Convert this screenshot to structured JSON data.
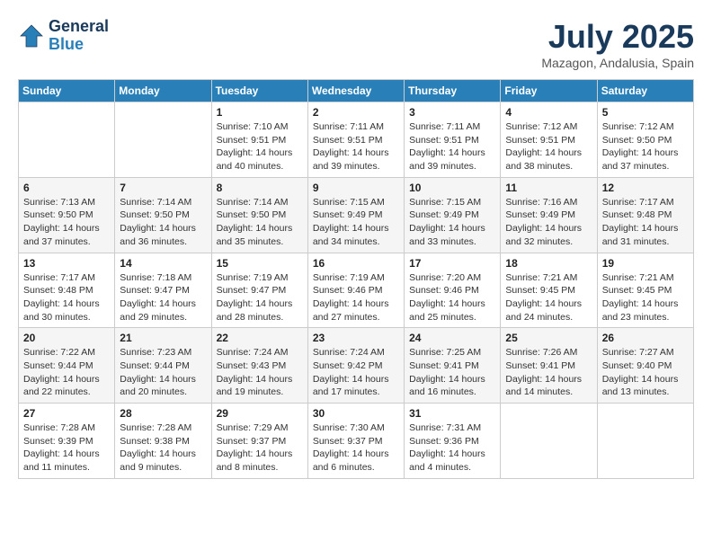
{
  "header": {
    "logo_line1": "General",
    "logo_line2": "Blue",
    "month_year": "July 2025",
    "location": "Mazagon, Andalusia, Spain"
  },
  "weekdays": [
    "Sunday",
    "Monday",
    "Tuesday",
    "Wednesday",
    "Thursday",
    "Friday",
    "Saturday"
  ],
  "weeks": [
    [
      {
        "day": "",
        "info": ""
      },
      {
        "day": "",
        "info": ""
      },
      {
        "day": "1",
        "info": "Sunrise: 7:10 AM\nSunset: 9:51 PM\nDaylight: 14 hours and 40 minutes."
      },
      {
        "day": "2",
        "info": "Sunrise: 7:11 AM\nSunset: 9:51 PM\nDaylight: 14 hours and 39 minutes."
      },
      {
        "day": "3",
        "info": "Sunrise: 7:11 AM\nSunset: 9:51 PM\nDaylight: 14 hours and 39 minutes."
      },
      {
        "day": "4",
        "info": "Sunrise: 7:12 AM\nSunset: 9:51 PM\nDaylight: 14 hours and 38 minutes."
      },
      {
        "day": "5",
        "info": "Sunrise: 7:12 AM\nSunset: 9:50 PM\nDaylight: 14 hours and 37 minutes."
      }
    ],
    [
      {
        "day": "6",
        "info": "Sunrise: 7:13 AM\nSunset: 9:50 PM\nDaylight: 14 hours and 37 minutes."
      },
      {
        "day": "7",
        "info": "Sunrise: 7:14 AM\nSunset: 9:50 PM\nDaylight: 14 hours and 36 minutes."
      },
      {
        "day": "8",
        "info": "Sunrise: 7:14 AM\nSunset: 9:50 PM\nDaylight: 14 hours and 35 minutes."
      },
      {
        "day": "9",
        "info": "Sunrise: 7:15 AM\nSunset: 9:49 PM\nDaylight: 14 hours and 34 minutes."
      },
      {
        "day": "10",
        "info": "Sunrise: 7:15 AM\nSunset: 9:49 PM\nDaylight: 14 hours and 33 minutes."
      },
      {
        "day": "11",
        "info": "Sunrise: 7:16 AM\nSunset: 9:49 PM\nDaylight: 14 hours and 32 minutes."
      },
      {
        "day": "12",
        "info": "Sunrise: 7:17 AM\nSunset: 9:48 PM\nDaylight: 14 hours and 31 minutes."
      }
    ],
    [
      {
        "day": "13",
        "info": "Sunrise: 7:17 AM\nSunset: 9:48 PM\nDaylight: 14 hours and 30 minutes."
      },
      {
        "day": "14",
        "info": "Sunrise: 7:18 AM\nSunset: 9:47 PM\nDaylight: 14 hours and 29 minutes."
      },
      {
        "day": "15",
        "info": "Sunrise: 7:19 AM\nSunset: 9:47 PM\nDaylight: 14 hours and 28 minutes."
      },
      {
        "day": "16",
        "info": "Sunrise: 7:19 AM\nSunset: 9:46 PM\nDaylight: 14 hours and 27 minutes."
      },
      {
        "day": "17",
        "info": "Sunrise: 7:20 AM\nSunset: 9:46 PM\nDaylight: 14 hours and 25 minutes."
      },
      {
        "day": "18",
        "info": "Sunrise: 7:21 AM\nSunset: 9:45 PM\nDaylight: 14 hours and 24 minutes."
      },
      {
        "day": "19",
        "info": "Sunrise: 7:21 AM\nSunset: 9:45 PM\nDaylight: 14 hours and 23 minutes."
      }
    ],
    [
      {
        "day": "20",
        "info": "Sunrise: 7:22 AM\nSunset: 9:44 PM\nDaylight: 14 hours and 22 minutes."
      },
      {
        "day": "21",
        "info": "Sunrise: 7:23 AM\nSunset: 9:44 PM\nDaylight: 14 hours and 20 minutes."
      },
      {
        "day": "22",
        "info": "Sunrise: 7:24 AM\nSunset: 9:43 PM\nDaylight: 14 hours and 19 minutes."
      },
      {
        "day": "23",
        "info": "Sunrise: 7:24 AM\nSunset: 9:42 PM\nDaylight: 14 hours and 17 minutes."
      },
      {
        "day": "24",
        "info": "Sunrise: 7:25 AM\nSunset: 9:41 PM\nDaylight: 14 hours and 16 minutes."
      },
      {
        "day": "25",
        "info": "Sunrise: 7:26 AM\nSunset: 9:41 PM\nDaylight: 14 hours and 14 minutes."
      },
      {
        "day": "26",
        "info": "Sunrise: 7:27 AM\nSunset: 9:40 PM\nDaylight: 14 hours and 13 minutes."
      }
    ],
    [
      {
        "day": "27",
        "info": "Sunrise: 7:28 AM\nSunset: 9:39 PM\nDaylight: 14 hours and 11 minutes."
      },
      {
        "day": "28",
        "info": "Sunrise: 7:28 AM\nSunset: 9:38 PM\nDaylight: 14 hours and 9 minutes."
      },
      {
        "day": "29",
        "info": "Sunrise: 7:29 AM\nSunset: 9:37 PM\nDaylight: 14 hours and 8 minutes."
      },
      {
        "day": "30",
        "info": "Sunrise: 7:30 AM\nSunset: 9:37 PM\nDaylight: 14 hours and 6 minutes."
      },
      {
        "day": "31",
        "info": "Sunrise: 7:31 AM\nSunset: 9:36 PM\nDaylight: 14 hours and 4 minutes."
      },
      {
        "day": "",
        "info": ""
      },
      {
        "day": "",
        "info": ""
      }
    ]
  ]
}
